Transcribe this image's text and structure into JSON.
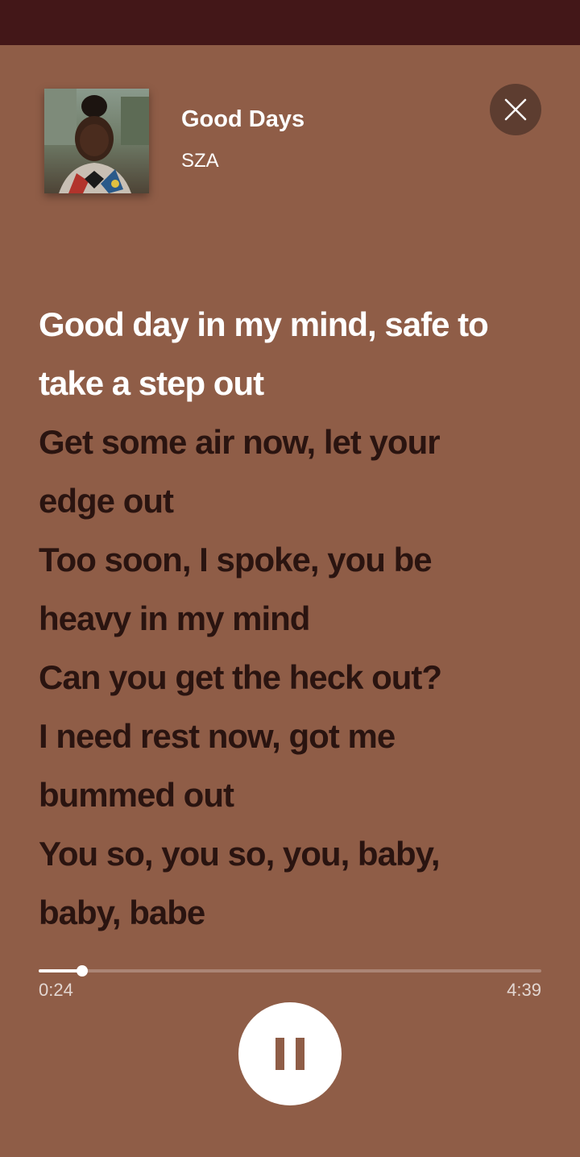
{
  "colors": {
    "status_bar": "#431718",
    "background": "#8f5d47",
    "close_button_bg": "#5d3d30",
    "lyric_active": "#ffffff",
    "lyric_inactive": "#2a1410"
  },
  "track": {
    "title": "Good Days",
    "artist": "SZA",
    "album_art": "album-cover-image"
  },
  "close_icon": "close-icon",
  "lyrics": [
    "Good day in my mind, safe to",
    "take a step out",
    "Get some air now, let your",
    "edge out",
    "Too soon, I spoke, you be",
    "heavy in my mind",
    "Can you get the heck out?",
    "I need rest now, got me",
    "bummed out",
    "You so, you so, you, baby,",
    "baby, babe"
  ],
  "active_lines": 2,
  "playback": {
    "elapsed": "0:24",
    "total": "4:39",
    "progress_fraction": 0.086,
    "control_icon": "pause-icon"
  }
}
